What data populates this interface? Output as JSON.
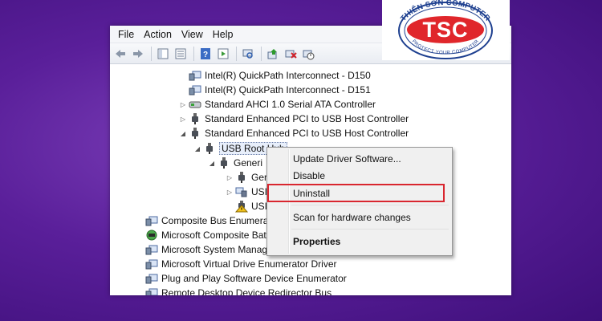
{
  "menu": [
    "File",
    "Action",
    "View",
    "Help"
  ],
  "toolbar_icons": [
    "back-icon",
    "forward-icon",
    "show-hide-tree-icon",
    "properties-icon",
    "help-icon",
    "details-icon",
    "scan-hardware-icon",
    "update-driver-icon",
    "uninstall-device-icon",
    "disable-device-icon"
  ],
  "tree": [
    {
      "label": "Intel(R) QuickPath Interconnect - D150",
      "icon": "system-device-icon"
    },
    {
      "label": "Intel(R) QuickPath Interconnect - D151",
      "icon": "system-device-icon"
    },
    {
      "label": "Standard AHCI 1.0 Serial ATA Controller",
      "icon": "ata-controller-icon"
    },
    {
      "label": "Standard Enhanced PCI to USB Host Controller",
      "icon": "usb-controller-icon"
    },
    {
      "label": "Standard Enhanced PCI to USB Host Controller",
      "icon": "usb-controller-icon"
    },
    {
      "label": "USB Root Hub",
      "icon": "usb-hub-icon"
    },
    {
      "label": "Generi",
      "icon": "usb-hub-icon"
    },
    {
      "label": "Ger",
      "icon": "usb-device-icon"
    },
    {
      "label": "USI",
      "icon": "usb-composite-icon"
    },
    {
      "label": "USI",
      "icon": "warning-device-icon"
    },
    {
      "label": "Composite Bus Enumerator",
      "icon": "system-device-icon"
    },
    {
      "label": "Microsoft Composite Battery",
      "icon": "battery-device-icon"
    },
    {
      "label": "Microsoft System Management BIOS Driver",
      "icon": "system-device-icon"
    },
    {
      "label": "Microsoft Virtual Drive Enumerator Driver",
      "icon": "system-device-icon"
    },
    {
      "label": "Plug and Play Software Device Enumerator",
      "icon": "system-device-icon"
    },
    {
      "label": "Remote Desktop Device Redirector Bus",
      "icon": "system-device-icon"
    }
  ],
  "context_menu": {
    "update": "Update Driver Software...",
    "disable": "Disable",
    "uninstall": "Uninstall",
    "scan": "Scan for hardware changes",
    "properties": "Properties"
  },
  "logo": {
    "top_text": "THIÊN SƠN COMPUTER",
    "bottom_text": "PROTECT YOUR COMPUTER",
    "brand": "TSC"
  },
  "colors": {
    "background": "#5a1f9a",
    "highlight_border": "#d9262f",
    "logo_red": "#e0262b",
    "logo_blue": "#1d3f8f"
  }
}
